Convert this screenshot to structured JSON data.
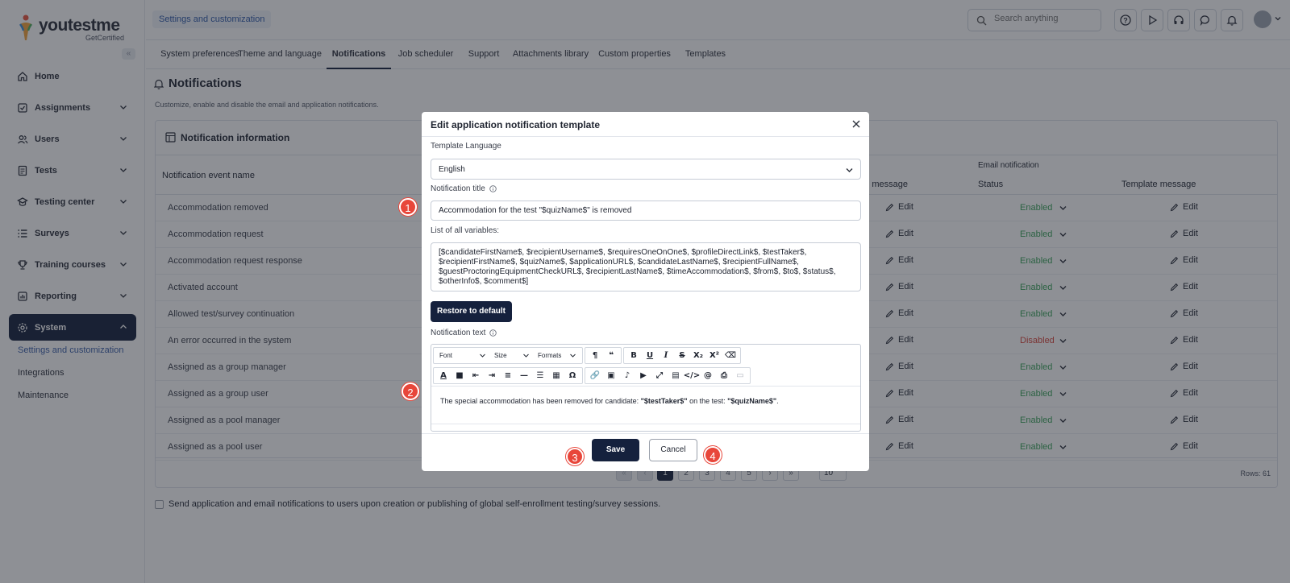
{
  "app": {
    "logo_main": "youtestme",
    "logo_accent": "e",
    "logo_sub": "GetCertified"
  },
  "breadcrumb": "Settings and customization",
  "search": {
    "placeholder": "Search anything"
  },
  "sidebar": {
    "collapse_label": "«",
    "items": [
      {
        "label": "Home",
        "icon": "home-icon"
      },
      {
        "label": "Assignments",
        "icon": "assignments-icon"
      },
      {
        "label": "Users",
        "icon": "users-icon"
      },
      {
        "label": "Tests",
        "icon": "tests-icon"
      },
      {
        "label": "Testing center",
        "icon": "testing-center-icon"
      },
      {
        "label": "Surveys",
        "icon": "surveys-icon"
      },
      {
        "label": "Training courses",
        "icon": "trophy-icon"
      },
      {
        "label": "Reporting",
        "icon": "reporting-icon"
      },
      {
        "label": "System",
        "icon": "gear-icon"
      }
    ],
    "subitems": [
      {
        "label": "Settings and customization"
      },
      {
        "label": "Integrations"
      },
      {
        "label": "Maintenance"
      }
    ]
  },
  "tabs": [
    {
      "label": "System preferences"
    },
    {
      "label": "Theme and language"
    },
    {
      "label": "Notifications"
    },
    {
      "label": "Job scheduler"
    },
    {
      "label": "Support"
    },
    {
      "label": "Attachments library"
    },
    {
      "label": "Custom properties"
    },
    {
      "label": "Templates"
    }
  ],
  "page": {
    "title": "Notifications",
    "description": "Customize, enable and disable the email and application notifications."
  },
  "card": {
    "title": "Notification information",
    "col_event": "Notification event name",
    "col_email_group": "Email notification",
    "col_template_message_partial": "ate message",
    "col_status": "Status",
    "col_template_message": "Template message",
    "edit_label": "Edit",
    "rows": [
      {
        "name": "Accommodation removed",
        "status": "Enabled"
      },
      {
        "name": "Accommodation request",
        "status": "Enabled"
      },
      {
        "name": "Accommodation request response",
        "status": "Enabled"
      },
      {
        "name": "Activated account",
        "status": "Enabled"
      },
      {
        "name": "Allowed test/survey continuation",
        "status": "Enabled"
      },
      {
        "name": "An error occurred in the system",
        "status": "Disabled"
      },
      {
        "name": "Assigned as a group manager",
        "status": "Enabled"
      },
      {
        "name": "Assigned as a group user",
        "status": "Enabled"
      },
      {
        "name": "Assigned as a pool manager",
        "status": "Enabled"
      },
      {
        "name": "Assigned as a pool user",
        "status": "Enabled"
      }
    ],
    "pager": {
      "first": "«",
      "prev": "‹",
      "pages": [
        "1",
        "2",
        "3",
        "4",
        "5"
      ],
      "next": "›",
      "last": "»",
      "page_size": "10",
      "rows_label": "Rows: 61"
    }
  },
  "bottom_option": "Send application and email notifications to users upon creation or publishing of global self-enrollment testing/survey sessions.",
  "modal": {
    "title": "Edit application notification template",
    "template_language_label": "Template Language",
    "template_language_value": "English",
    "notification_title_label": "Notification title",
    "notification_title_value": "Accommodation for the test \"$quizName$\" is removed",
    "variables_label": "List of all variables:",
    "variables_value": "[$candidateFirstName$, $recipientUsername$, $requiresOneOnOne$, $profileDirectLink$, $testTaker$, $recipientFirstName$, $quizName$, $applicationURL$, $candidateLastName$, $recipientFullName$, $guestProctoringEquipmentCheckURL$, $recipientLastName$, $timeAccommodation$, $from$, $to$, $status$, $otherInfo$, $comment$]",
    "restore_label": "Restore to default",
    "notification_text_label": "Notification text",
    "editor": {
      "font_label": "Font",
      "size_label": "Size",
      "formats_label": "Formats",
      "body_prefix": "The special accommodation has been removed for candidate: ",
      "body_var1": "\"$testTaker$\"",
      "body_middle": " on the test: ",
      "body_var2": "\"$quizName$\"",
      "body_suffix": "."
    },
    "save_label": "Save",
    "cancel_label": "Cancel"
  },
  "markers": [
    "1",
    "2",
    "3",
    "4"
  ],
  "colors": {
    "navy": "#15213d",
    "enabled": "#3aa35a",
    "disabled": "#d9453b",
    "marker": "#e8463a"
  }
}
